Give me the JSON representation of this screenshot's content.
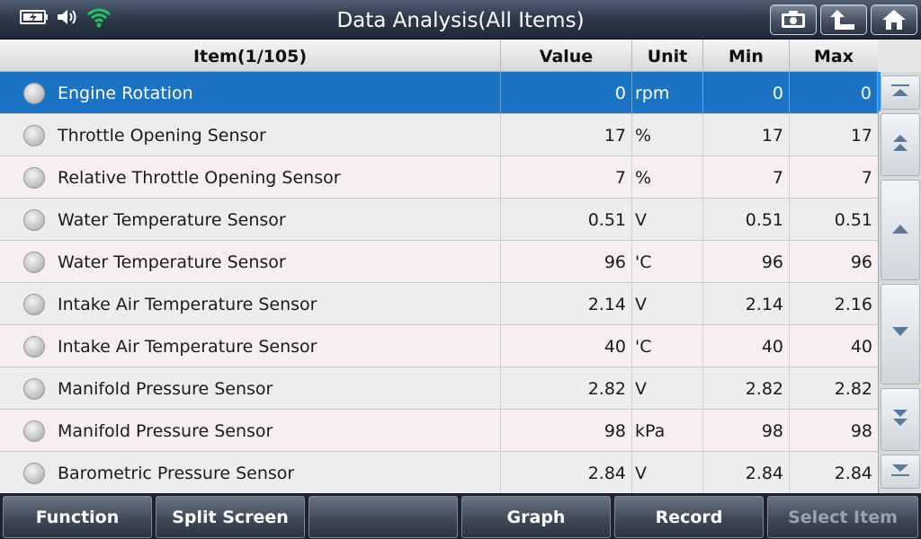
{
  "header": {
    "title": "Data Analysis(All Items)",
    "status_icons": [
      "battery-charging-icon",
      "speaker-icon",
      "wifi-icon"
    ],
    "buttons": [
      "screenshot-icon",
      "back-arrow-icon",
      "home-icon"
    ]
  },
  "table": {
    "columns": {
      "item": "Item(1/105)",
      "value": "Value",
      "unit": "Unit",
      "min": "Min",
      "max": "Max"
    },
    "rows": [
      {
        "item": "Engine Rotation",
        "value": "0",
        "unit": "rpm",
        "min": "0",
        "max": "0"
      },
      {
        "item": "Throttle Opening Sensor",
        "value": "17",
        "unit": "%",
        "min": "17",
        "max": "17"
      },
      {
        "item": "Relative Throttle Opening Sensor",
        "value": "7",
        "unit": "%",
        "min": "7",
        "max": "7"
      },
      {
        "item": "Water Temperature Sensor",
        "value": "0.51",
        "unit": "V",
        "min": "0.51",
        "max": "0.51"
      },
      {
        "item": "Water Temperature Sensor",
        "value": "96",
        "unit": "'C",
        "min": "96",
        "max": "96"
      },
      {
        "item": "Intake Air Temperature Sensor",
        "value": "2.14",
        "unit": "V",
        "min": "2.14",
        "max": "2.16"
      },
      {
        "item": "Intake Air Temperature Sensor",
        "value": "40",
        "unit": "'C",
        "min": "40",
        "max": "40"
      },
      {
        "item": "Manifold Pressure Sensor",
        "value": "2.82",
        "unit": "V",
        "min": "2.82",
        "max": "2.82"
      },
      {
        "item": "Manifold Pressure Sensor",
        "value": "98",
        "unit": "kPa",
        "min": "98",
        "max": "98"
      },
      {
        "item": "Barometric Pressure Sensor",
        "value": "2.84",
        "unit": "V",
        "min": "2.84",
        "max": "2.84"
      }
    ]
  },
  "scrollbar": {
    "buttons": [
      "scroll-top-icon",
      "page-up-icon",
      "scroll-up-icon",
      "scroll-down-icon",
      "page-down-icon",
      "scroll-bottom-icon"
    ]
  },
  "toolbar": {
    "function": "Function",
    "split_screen": "Split Screen",
    "empty": "",
    "graph": "Graph",
    "record": "Record",
    "select_item": "Select Item"
  },
  "colors": {
    "selected_row": "#1a73c4",
    "title_bar": "#2f3b4c",
    "wifi": "#22c55e"
  }
}
